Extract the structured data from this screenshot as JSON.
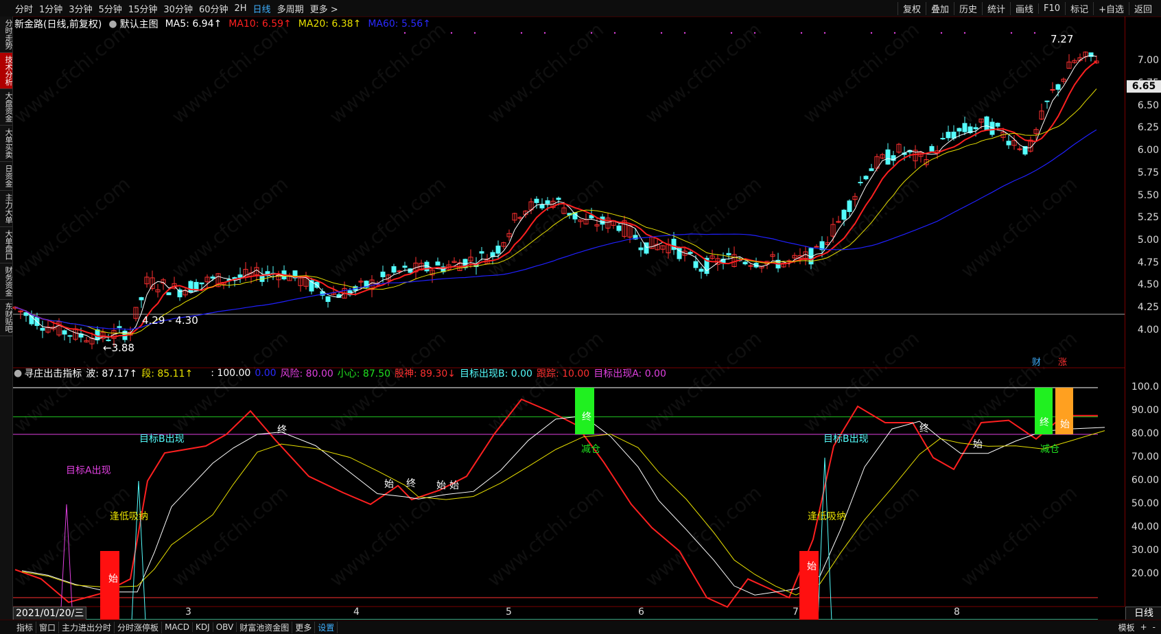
{
  "toolbar": {
    "periods": [
      "分时",
      "1分钟",
      "3分钟",
      "5分钟",
      "15分钟",
      "30分钟",
      "60分钟",
      "2H",
      "日线",
      "多周期",
      "更多 >"
    ],
    "active_period": "日线",
    "right_buttons": [
      "复权",
      "叠加",
      "历史",
      "统计",
      "画线",
      "F10",
      "标记",
      "+自选",
      "返回"
    ]
  },
  "sidebar": {
    "tabs": [
      "分时走势",
      "技术分析",
      "大盘资金",
      "大单买卖",
      "日资金",
      "主力大单",
      "大单盘口",
      "财务资金",
      "东财贴吧"
    ],
    "active": "技术分析"
  },
  "main_legend": {
    "title": "新金路(日线,前复权)",
    "template": "默认主图",
    "ma5": "MA5: 6.94↑",
    "ma10": "MA10: 6.59↑",
    "ma20": "MA20: 6.38↑",
    "ma60": "MA60: 5.56↑"
  },
  "indicator_legend": {
    "name": "寻庄出击指标",
    "bo": "波: 87.17↑",
    "duan": "段: 85.11↑",
    "blank": ": 100.00",
    "blue0": "0.00",
    "fengxian": "风险: 80.00",
    "xiaoxin": "小心: 87.50",
    "gushen": "股神: 89.30↓",
    "mubiao_b": "目标出现B: 0.00",
    "genzong": "跟踪: 10.00",
    "mubiao_a": "目标出现A: 0.00"
  },
  "price_axis": [
    "7.00",
    "6.75",
    "6.50",
    "6.25",
    "6.00",
    "5.75",
    "5.50",
    "5.25",
    "5.00",
    "4.75",
    "4.50",
    "4.25",
    "4.00"
  ],
  "current_price": "6.65",
  "indicator_axis": [
    "100.0",
    "90.00",
    "80.00",
    "70.00",
    "60.00",
    "50.00",
    "40.00",
    "30.00",
    "20.00"
  ],
  "annotations": {
    "high": "7.27",
    "low": "3.88",
    "range": "4.29 - 4.30",
    "cai": "财",
    "zhang": "涨",
    "target_a": "目标A出现",
    "target_b1": "目标B出现",
    "target_b2": "目标B出现",
    "buy1": "逢低吸纳",
    "buy2": "逢低吸纳",
    "reduce1": "减仓",
    "reduce2": "减仓",
    "start": "始",
    "end": "终"
  },
  "date_axis": {
    "current": "2021/01/20/三",
    "months": [
      "3",
      "4",
      "5",
      "6",
      "7",
      "8"
    ],
    "right_label": "日线"
  },
  "bottom_tabs": [
    "指标",
    "窗口",
    "主力进出分时",
    "分时涨停板",
    "MACD",
    "KDJ",
    "OBV",
    "财富池资金图",
    "更多",
    "设置"
  ],
  "bottom_active": "设置",
  "bottom_right": [
    "模板",
    "+",
    "-"
  ],
  "watermark": "www.cfchi.com",
  "colors": {
    "up": "#ff3030",
    "down": "#54fcfc",
    "ma5": "#ffffff",
    "ma10": "#ff2020",
    "ma20": "#e8e000",
    "ma60": "#2020ff"
  }
}
